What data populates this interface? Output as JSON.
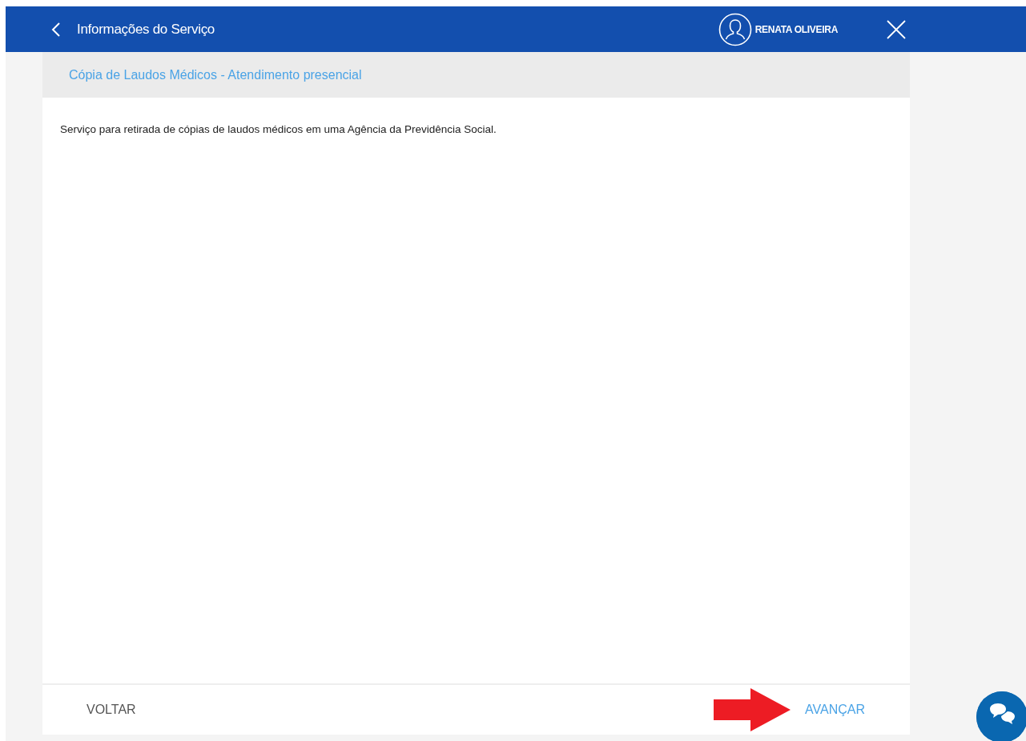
{
  "header": {
    "title": "Informações do Serviço",
    "user_name": "RENATA OLIVEIRA"
  },
  "service": {
    "title": "Cópia de Laudos Médicos - Atendimento presencial",
    "description": "Serviço para retirada de cópias de laudos médicos em uma Agência da Previdência Social."
  },
  "footer": {
    "back_label": "VOLTAR",
    "next_label": "AVANÇAR"
  }
}
